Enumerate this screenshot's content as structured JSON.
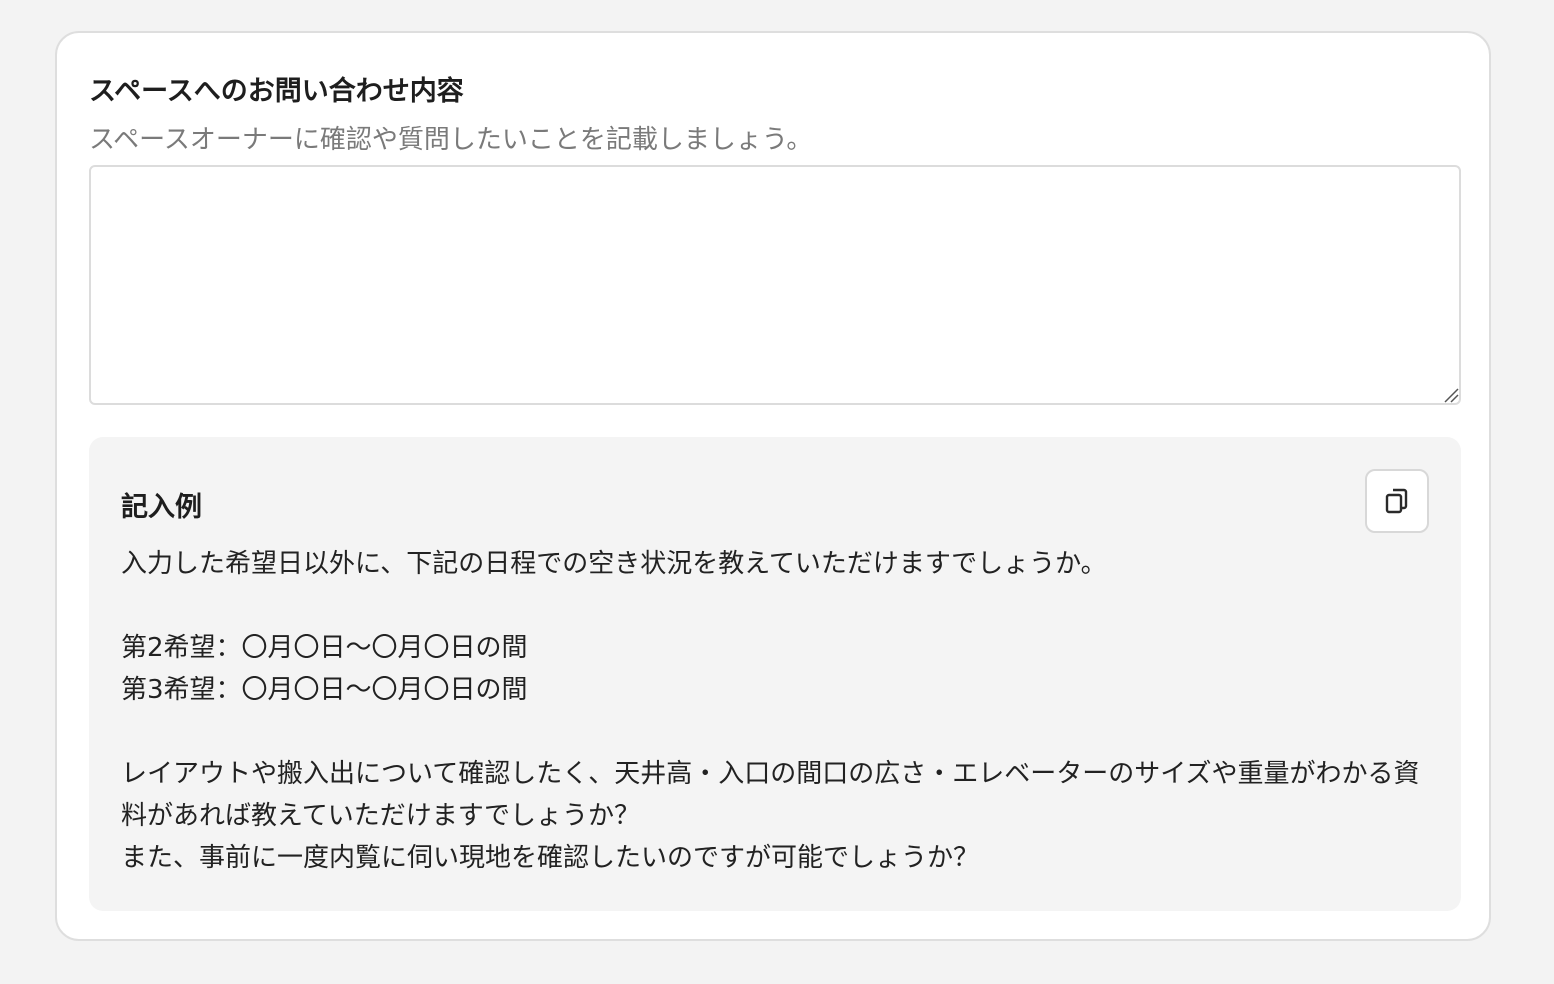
{
  "form": {
    "title": "スペースへのお問い合わせ内容",
    "help_text": "スペースオーナーに確認や質問したいことを記載しましょう。",
    "textarea": {
      "value": "",
      "placeholder": ""
    }
  },
  "example": {
    "title": "記入例",
    "copy_icon": "copy-icon",
    "body": "入力した希望日以外に、下記の日程での空き状況を教えていただけますでしょうか。\n\n第2希望：〇月〇日〜〇月〇日の間\n第3希望：〇月〇日〜〇月〇日の間\n\nレイアウトや搬入出について確認したく、天井高・入口の間口の広さ・エレベーターのサイズや重量がわかる資料があれば教えていただけますでしょうか？\nまた、事前に一度内覧に伺い現地を確認したいのですが可能でしょうか？"
  },
  "colors": {
    "page_background": "#f3f3f3",
    "card_background": "#ffffff",
    "example_background": "#f4f4f4",
    "help_text": "#7a7a7a",
    "text": "#222222"
  }
}
